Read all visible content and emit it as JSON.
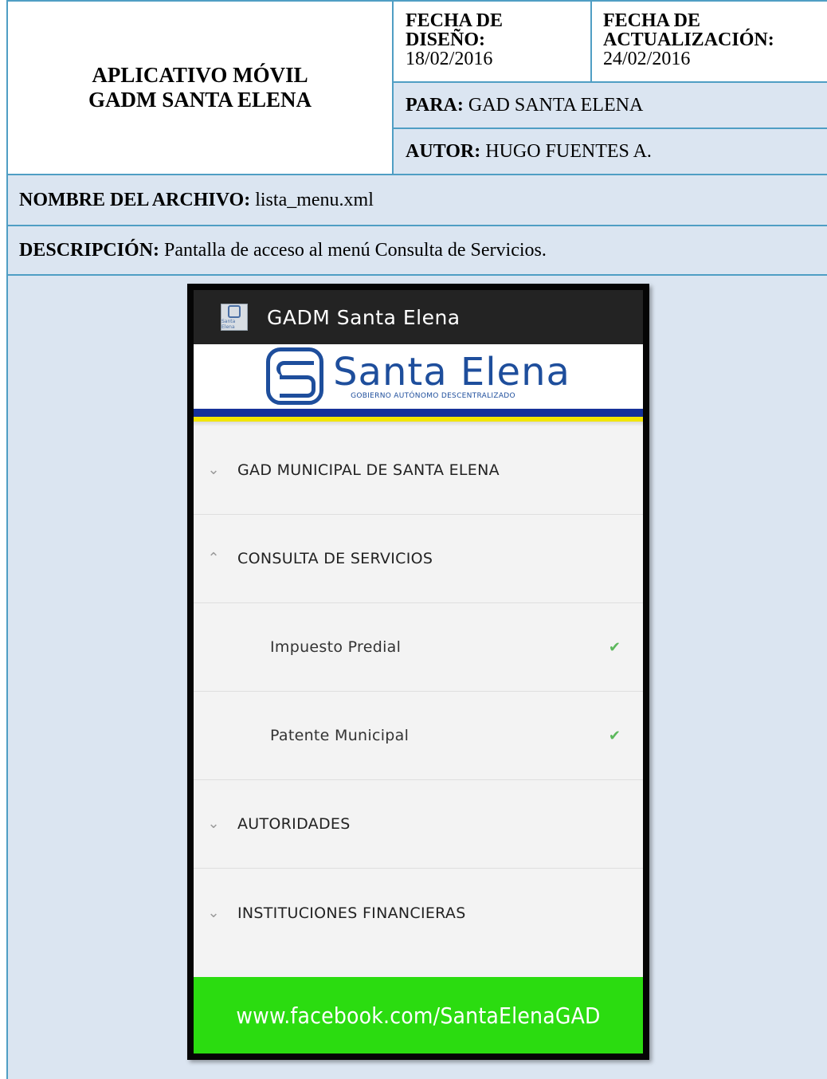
{
  "header": {
    "title_line1": "APLICATIVO MÓVIL",
    "title_line2": "GADM SANTA ELENA",
    "fecha_diseno_label_1": "FECHA DE",
    "fecha_diseno_label_2": "DISEÑO:",
    "fecha_diseno_value": "18/02/2016",
    "fecha_actualizacion_label_1": "FECHA DE",
    "fecha_actualizacion_label_2": "ACTUALIZACIÓN:",
    "fecha_actualizacion_value": "24/02/2016",
    "para_label": "PARA:",
    "para_value": "GAD SANTA ELENA",
    "autor_label": "AUTOR:",
    "autor_value": "HUGO FUENTES A."
  },
  "file": {
    "label": "NOMBRE DEL ARCHIVO:",
    "value": "lista_menu.xml"
  },
  "description": {
    "label": "DESCRIPCIÓN:",
    "value": "Pantalla de acceso al menú Consulta de Servicios."
  },
  "app": {
    "title": "GADM Santa Elena",
    "icon_text": "Santa Elena",
    "logo_name": "Santa Elena",
    "logo_subtitle": "GOBIERNO AUTÓNOMO DESCENTRALIZADO",
    "menu": [
      {
        "label": "GAD MUNICIPAL DE SANTA ELENA",
        "icon": "chevron-down-icon"
      },
      {
        "label": "CONSULTA DE SERVICIOS",
        "icon": "chevron-up-icon"
      },
      {
        "label": "Impuesto Predial",
        "icon": "check-icon"
      },
      {
        "label": "Patente Municipal",
        "icon": "check-icon"
      },
      {
        "label": "AUTORIDADES",
        "icon": "chevron-down-icon"
      },
      {
        "label": "INSTITUCIONES FINANCIERAS",
        "icon": "chevron-down-icon"
      }
    ],
    "footer_link": "www.facebook.com/SantaElenaGAD",
    "colors": {
      "appbar": "#232323",
      "brand_blue": "#1e4e9c",
      "stripe_yellow": "#f2e500",
      "footer_green": "#2bdc10",
      "table_border": "#4f9ec4",
      "cell_fill": "#dbe5f1"
    }
  }
}
